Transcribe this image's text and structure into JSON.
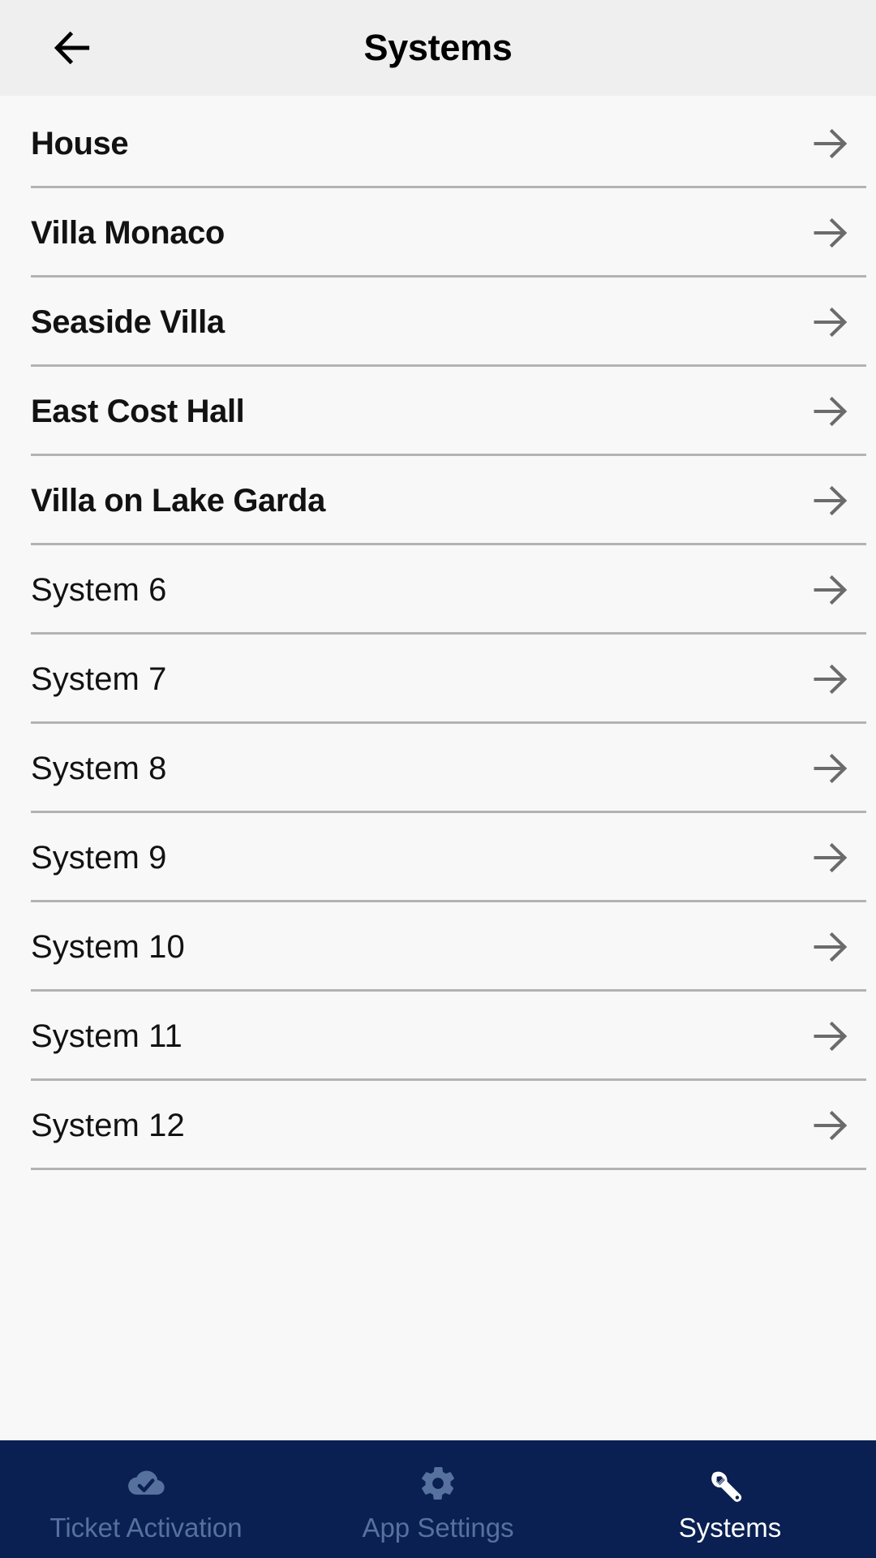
{
  "header": {
    "title": "Systems",
    "back_icon": "arrow-left-icon",
    "background": "#efefef"
  },
  "list": {
    "rows": [
      {
        "label": "House",
        "bold": true,
        "arrow_icon": "arrow-right-icon"
      },
      {
        "label": "Villa Monaco",
        "bold": true,
        "arrow_icon": "arrow-right-icon"
      },
      {
        "label": "Seaside Villa",
        "bold": true,
        "arrow_icon": "arrow-right-icon"
      },
      {
        "label": "East Cost Hall",
        "bold": true,
        "arrow_icon": "arrow-right-icon"
      },
      {
        "label": "Villa on Lake Garda",
        "bold": true,
        "arrow_icon": "arrow-right-icon"
      },
      {
        "label": "System 6",
        "bold": false,
        "arrow_icon": "arrow-right-icon"
      },
      {
        "label": "System 7",
        "bold": false,
        "arrow_icon": "arrow-right-icon"
      },
      {
        "label": "System 8",
        "bold": false,
        "arrow_icon": "arrow-right-icon"
      },
      {
        "label": "System 9",
        "bold": false,
        "arrow_icon": "arrow-right-icon"
      },
      {
        "label": "System 10",
        "bold": false,
        "arrow_icon": "arrow-right-icon"
      },
      {
        "label": "System 11",
        "bold": false,
        "arrow_icon": "arrow-right-icon"
      },
      {
        "label": "System 12",
        "bold": false,
        "arrow_icon": "arrow-right-icon"
      }
    ],
    "divider_color": "#b3b3b3",
    "arrow_color": "#6b6b6b",
    "background": "#f8f8f8"
  },
  "tab_bar": {
    "background": "#0a2052",
    "active_color": "#ffffff",
    "inactive_color": "#56719e",
    "tabs": [
      {
        "label": "Ticket Activation",
        "icon": "cloud-check-icon",
        "active": false
      },
      {
        "label": "App Settings",
        "icon": "gear-icon",
        "active": false
      },
      {
        "label": "Systems",
        "icon": "wrench-icon",
        "active": true
      }
    ]
  }
}
